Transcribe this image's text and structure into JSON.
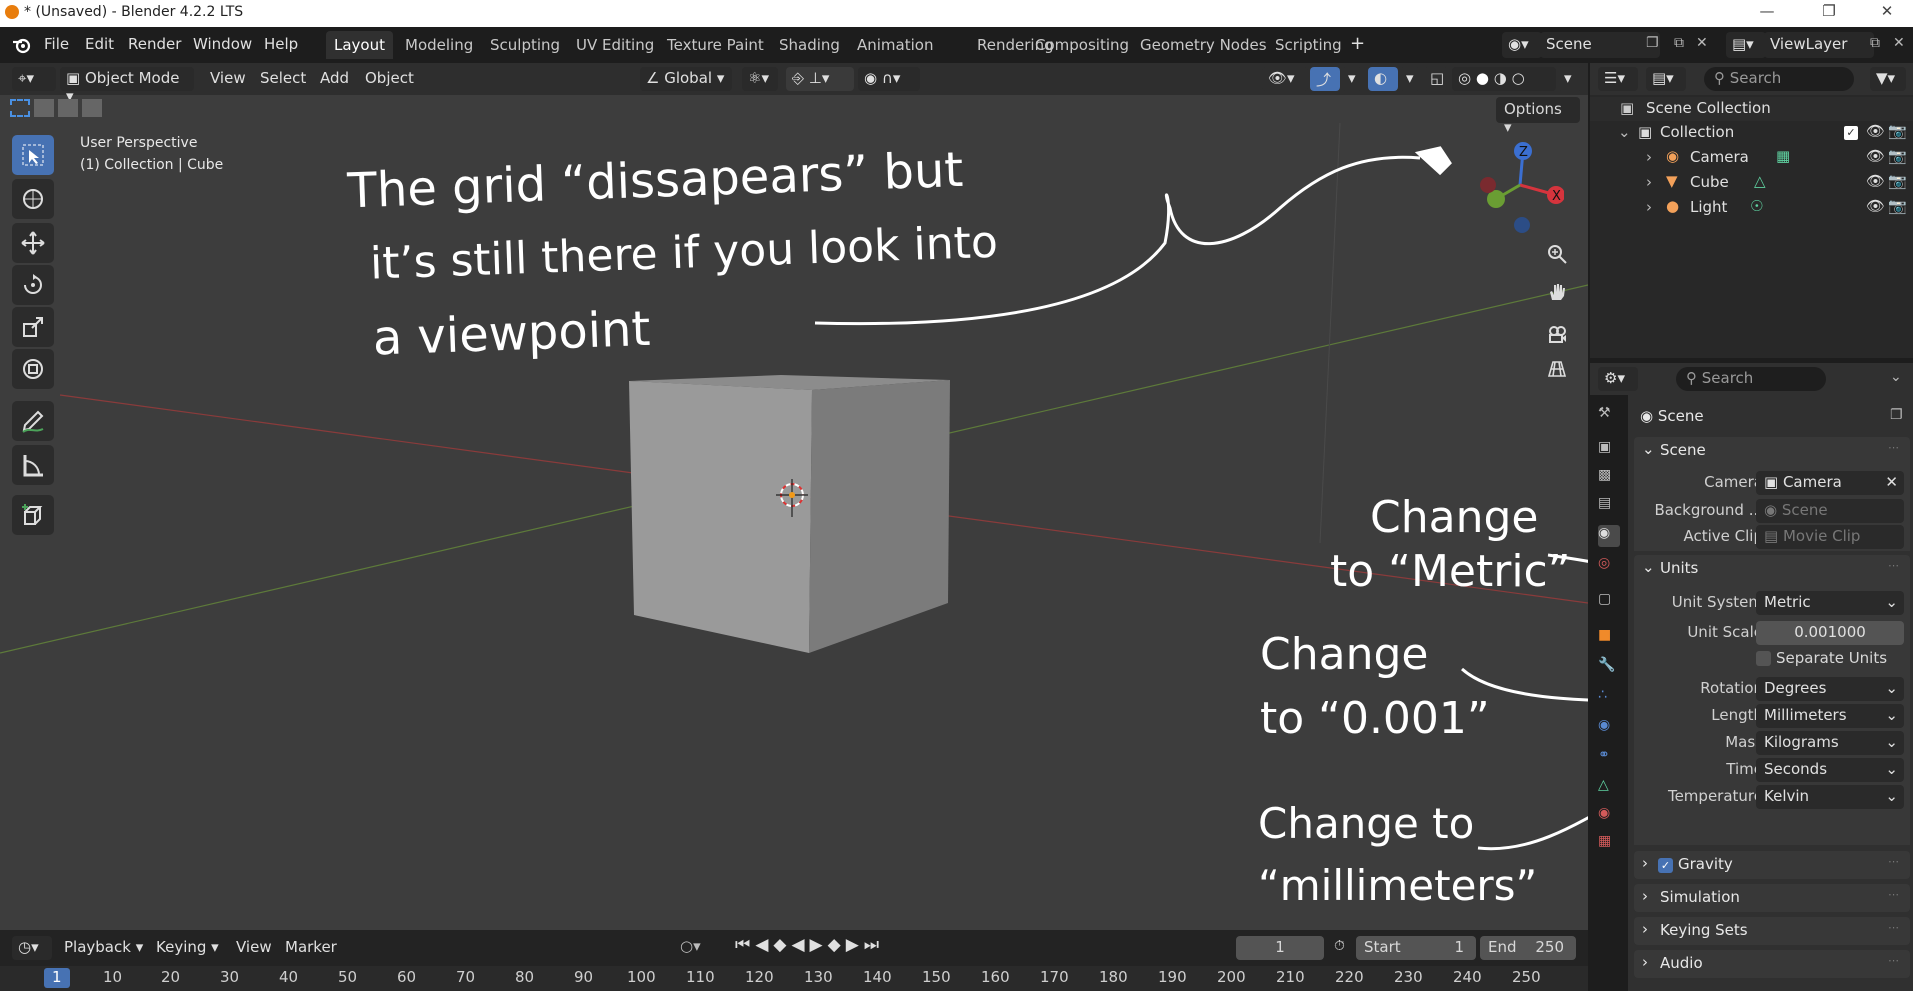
{
  "titlebar": {
    "title": "* (Unsaved) - Blender 4.2.2 LTS",
    "minimize": "—",
    "maximize": "❐",
    "close": "✕"
  },
  "menubar": {
    "menus": [
      "File",
      "Edit",
      "Render",
      "Window",
      "Help"
    ],
    "workspaces": [
      "Layout",
      "Modeling",
      "Sculpting",
      "UV Editing",
      "Texture Paint",
      "Shading",
      "Animation",
      "Rendering",
      "Compositing",
      "Geometry Nodes",
      "Scripting"
    ],
    "active_workspace": "Layout",
    "add_workspace": "+",
    "scene_name": "Scene",
    "view_layer": "ViewLayer"
  },
  "viewport": {
    "mode": "Object Mode",
    "menus": [
      "View",
      "Select",
      "Add",
      "Object"
    ],
    "orientation": "Global",
    "options_label": "Options",
    "info_line1": "User Perspective",
    "info_line2": "(1) Collection | Cube",
    "gizmo": {
      "z": "Z",
      "x": "X",
      "y": "Y"
    }
  },
  "annotations": {
    "grid_note": [
      "The grid “dissapears” but",
      "it’s still there if you look into",
      "a viewpoint"
    ],
    "metric_note": [
      "Change",
      "to “Metric”"
    ],
    "scale_note": [
      "Change",
      "to “0.001”"
    ],
    "mm_note": [
      "Change to",
      "“millimeters”"
    ]
  },
  "outliner": {
    "search_placeholder": "Search",
    "scene_collection": "Scene Collection",
    "collection": "Collection",
    "items": [
      "Camera",
      "Cube",
      "Light"
    ]
  },
  "properties": {
    "search_placeholder": "Search",
    "context_title": "Scene",
    "scene_panel": {
      "title": "Scene",
      "camera_label": "Camera",
      "camera_value": "Camera",
      "background_label": "Background ...",
      "background_value": "Scene",
      "clip_label": "Active Clip",
      "clip_value": "Movie Clip"
    },
    "units_panel": {
      "title": "Units",
      "unit_system_label": "Unit System",
      "unit_system_value": "Metric",
      "unit_scale_label": "Unit Scale",
      "unit_scale_value": "0.001000",
      "separate_units_label": "Separate Units",
      "rotation_label": "Rotation",
      "rotation_value": "Degrees",
      "length_label": "Length",
      "length_value": "Millimeters",
      "mass_label": "Mass",
      "mass_value": "Kilograms",
      "time_label": "Time",
      "time_value": "Seconds",
      "temperature_label": "Temperature",
      "temperature_value": "Kelvin"
    },
    "collapsed_panels": [
      "Gravity",
      "Simulation",
      "Keying Sets",
      "Audio"
    ]
  },
  "timeline": {
    "menus": [
      "Playback",
      "Keying",
      "View",
      "Marker"
    ],
    "current_frame": "1",
    "start_label": "Start",
    "start_value": "1",
    "end_label": "End",
    "end_value": "250",
    "ruler": [
      "1",
      "10",
      "20",
      "30",
      "40",
      "50",
      "60",
      "70",
      "80",
      "90",
      "100",
      "110",
      "120",
      "130",
      "140",
      "150",
      "160",
      "170",
      "180",
      "190",
      "200",
      "210",
      "220",
      "230",
      "240",
      "250"
    ]
  }
}
